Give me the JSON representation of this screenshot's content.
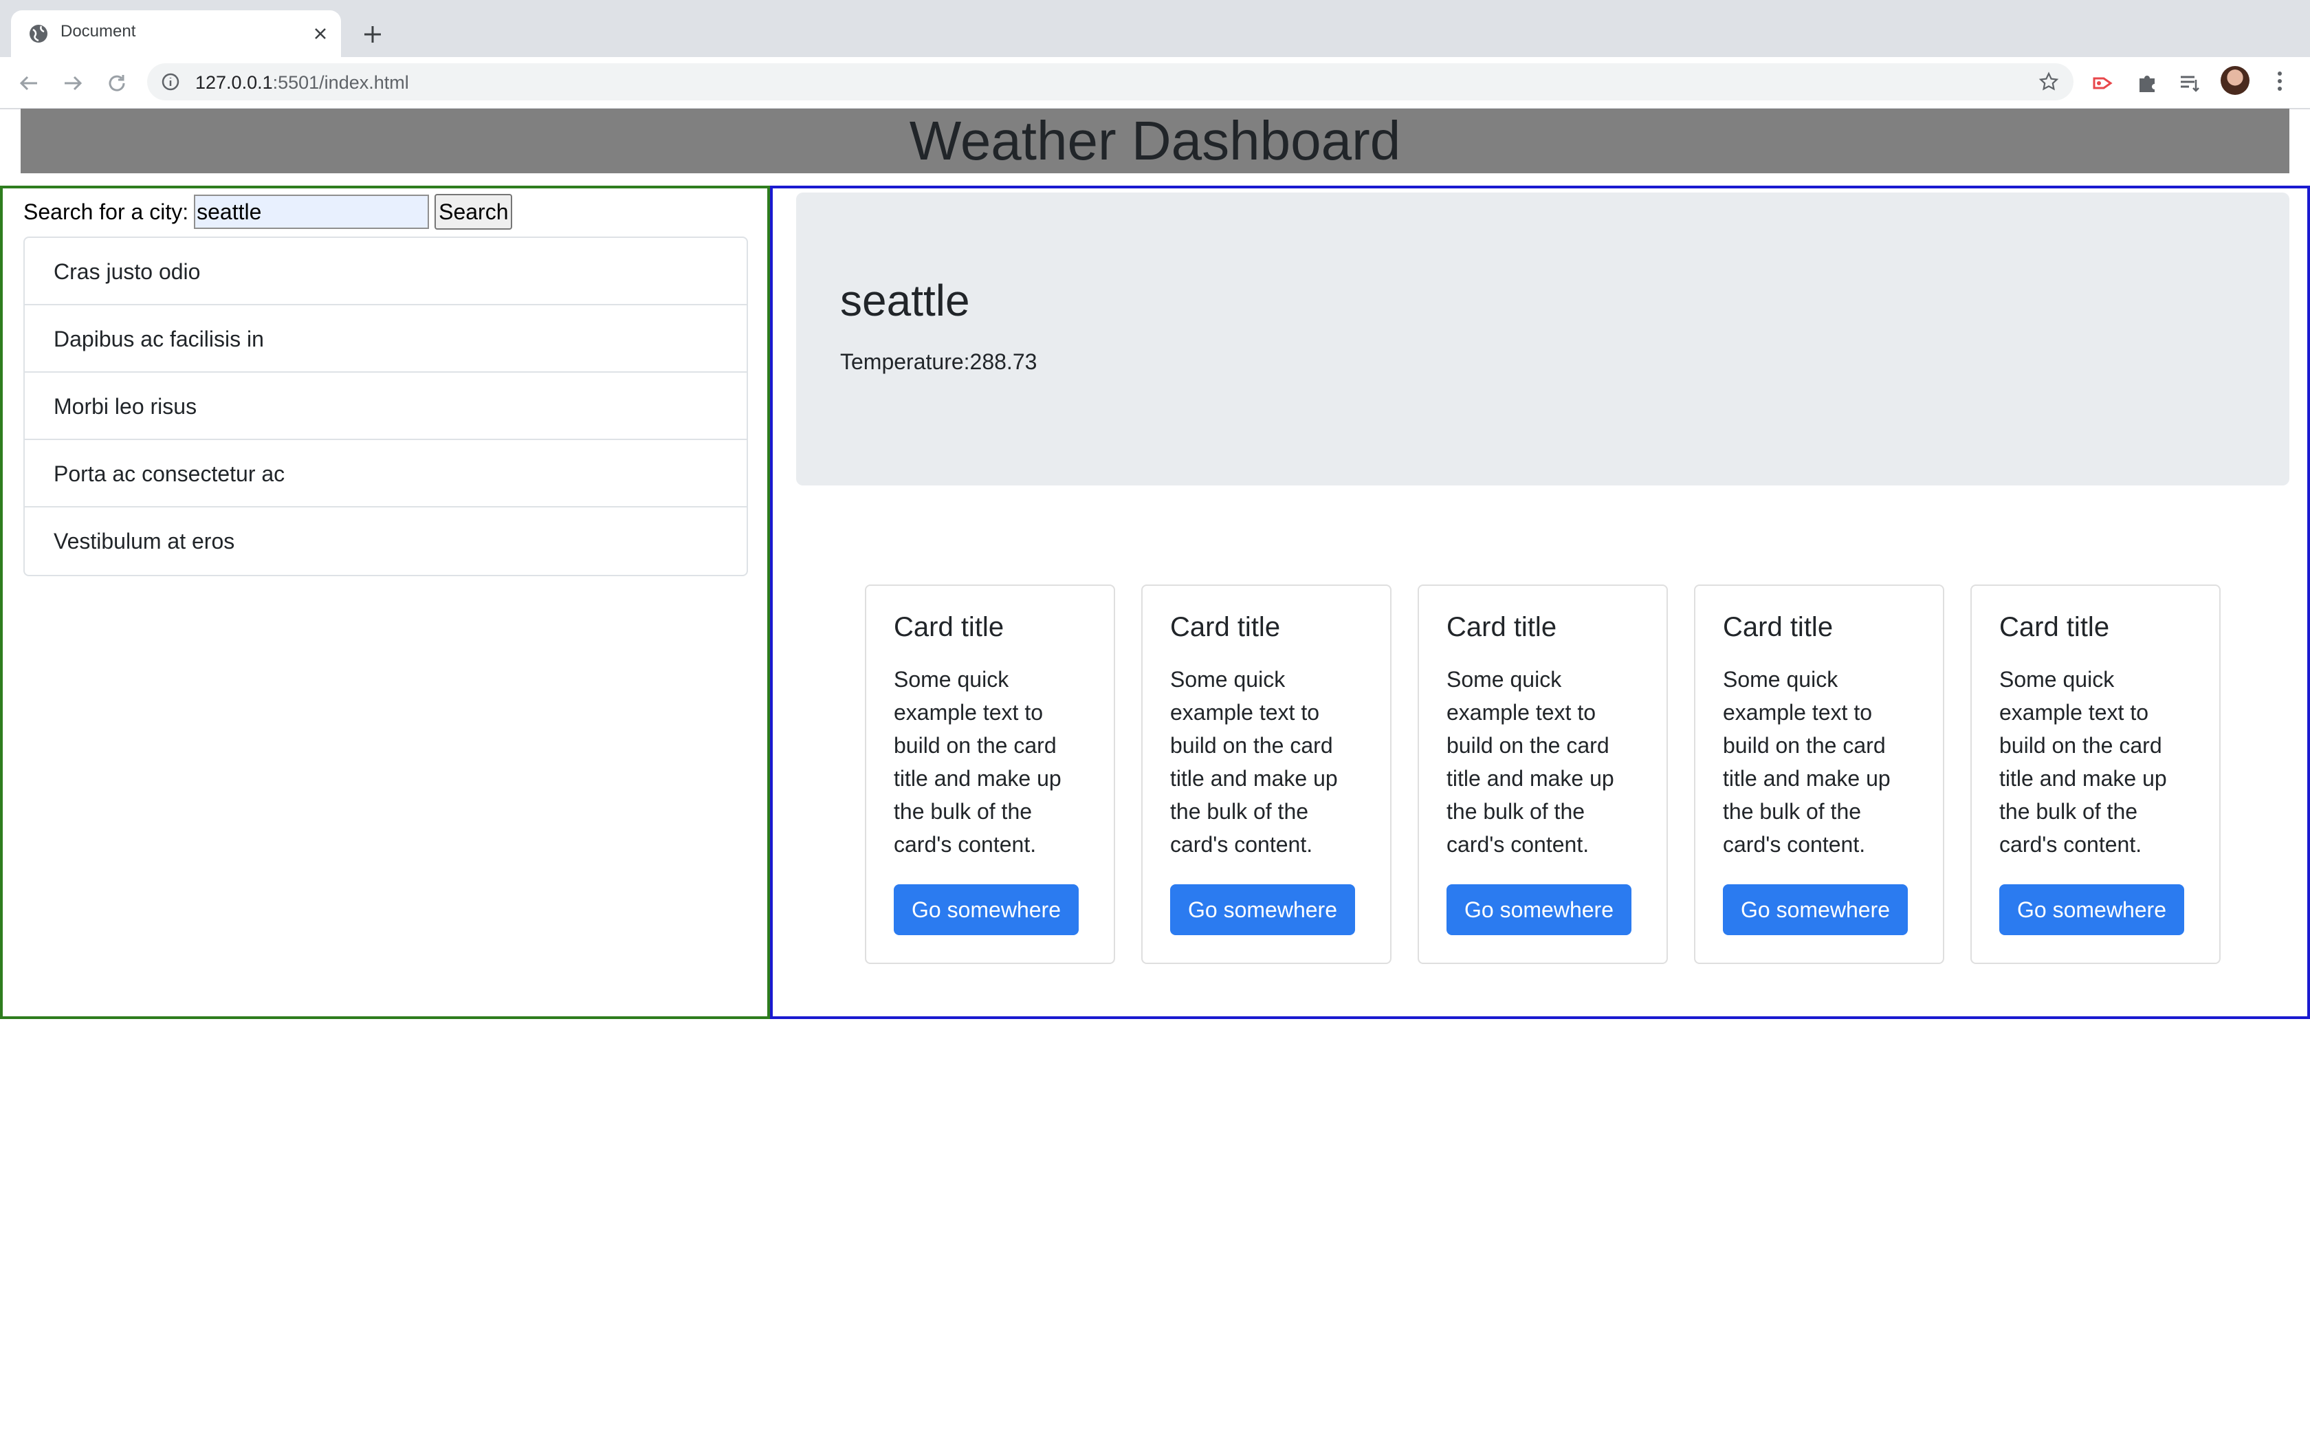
{
  "browser": {
    "tab_title": "Document",
    "url_host": "127.0.0.1",
    "url_rest": ":5501/index.html"
  },
  "header": {
    "title": "Weather Dashboard"
  },
  "search": {
    "label": "Search for a city:",
    "value": "seattle",
    "button_label": "Search"
  },
  "city_list": [
    "Cras justo odio",
    "Dapibus ac facilisis in",
    "Morbi leo risus",
    "Porta ac consectetur ac",
    "Vestibulum at eros"
  ],
  "current": {
    "city": "seattle",
    "temperature_label": "Temperature:",
    "temperature_value": "288.73"
  },
  "cards": [
    {
      "title": "Card title",
      "text": "Some quick example text to build on the card title and make up the bulk of the card's content.",
      "button": "Go somewhere"
    },
    {
      "title": "Card title",
      "text": "Some quick example text to build on the card title and make up the bulk of the card's content.",
      "button": "Go somewhere"
    },
    {
      "title": "Card title",
      "text": "Some quick example text to build on the card title and make up the bulk of the card's content.",
      "button": "Go somewhere"
    },
    {
      "title": "Card title",
      "text": "Some quick example text to build on the card title and make up the bulk of the card's content.",
      "button": "Go somewhere"
    },
    {
      "title": "Card title",
      "text": "Some quick example text to build on the card title and make up the bulk of the card's content.",
      "button": "Go somewhere"
    }
  ],
  "colors": {
    "left_panel_border": "#2e7d1e",
    "right_panel_border": "#1a1ad0",
    "header_bg": "#808080",
    "button_primary": "#2b7bf0"
  }
}
